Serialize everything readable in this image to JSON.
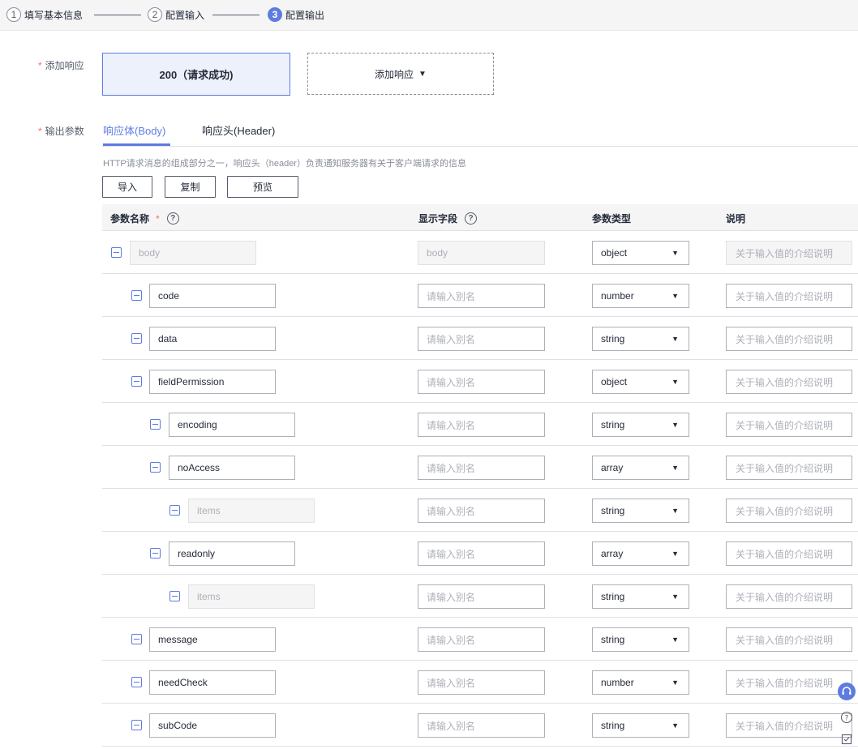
{
  "steps": [
    {
      "num": "1",
      "label": "填写基本信息"
    },
    {
      "num": "2",
      "label": "配置输入"
    },
    {
      "num": "3",
      "label": "配置输出"
    }
  ],
  "form": {
    "add_response_label": "添加响应",
    "output_params_label": "输出参数",
    "response_selected": "200（请求成功)",
    "add_response_button": "添加响应"
  },
  "tabs": {
    "body": "响应体(Body)",
    "header": "响应头(Header)"
  },
  "hint": "HTTP请求消息的组成部分之一，响应头（header）负责通知服务器有关于客户端请求的信息",
  "buttons": {
    "import": "导入",
    "copy": "复制",
    "preview": "预览"
  },
  "table": {
    "headers": {
      "name": "参数名称",
      "display": "显示字段",
      "type": "参数类型",
      "desc": "说明"
    },
    "alias_placeholder": "请输入别名",
    "desc_placeholder": "关于输入值的介绍说明",
    "rows": [
      {
        "name": "body",
        "display": "body",
        "type": "object"
      },
      {
        "name": "code",
        "type": "number"
      },
      {
        "name": "data",
        "type": "string"
      },
      {
        "name": "fieldPermission",
        "type": "object"
      },
      {
        "name": "encoding",
        "type": "string"
      },
      {
        "name": "noAccess",
        "type": "array"
      },
      {
        "name": "items",
        "type": "string"
      },
      {
        "name": "readonly",
        "type": "array"
      },
      {
        "name": "items",
        "type": "string"
      },
      {
        "name": "message",
        "type": "string"
      },
      {
        "name": "needCheck",
        "type": "number"
      },
      {
        "name": "subCode",
        "type": "string"
      }
    ]
  },
  "icons": {
    "help": "?",
    "caret": "▼"
  },
  "colors": {
    "accent": "#5e7ce0",
    "required": "#f66f6a"
  }
}
